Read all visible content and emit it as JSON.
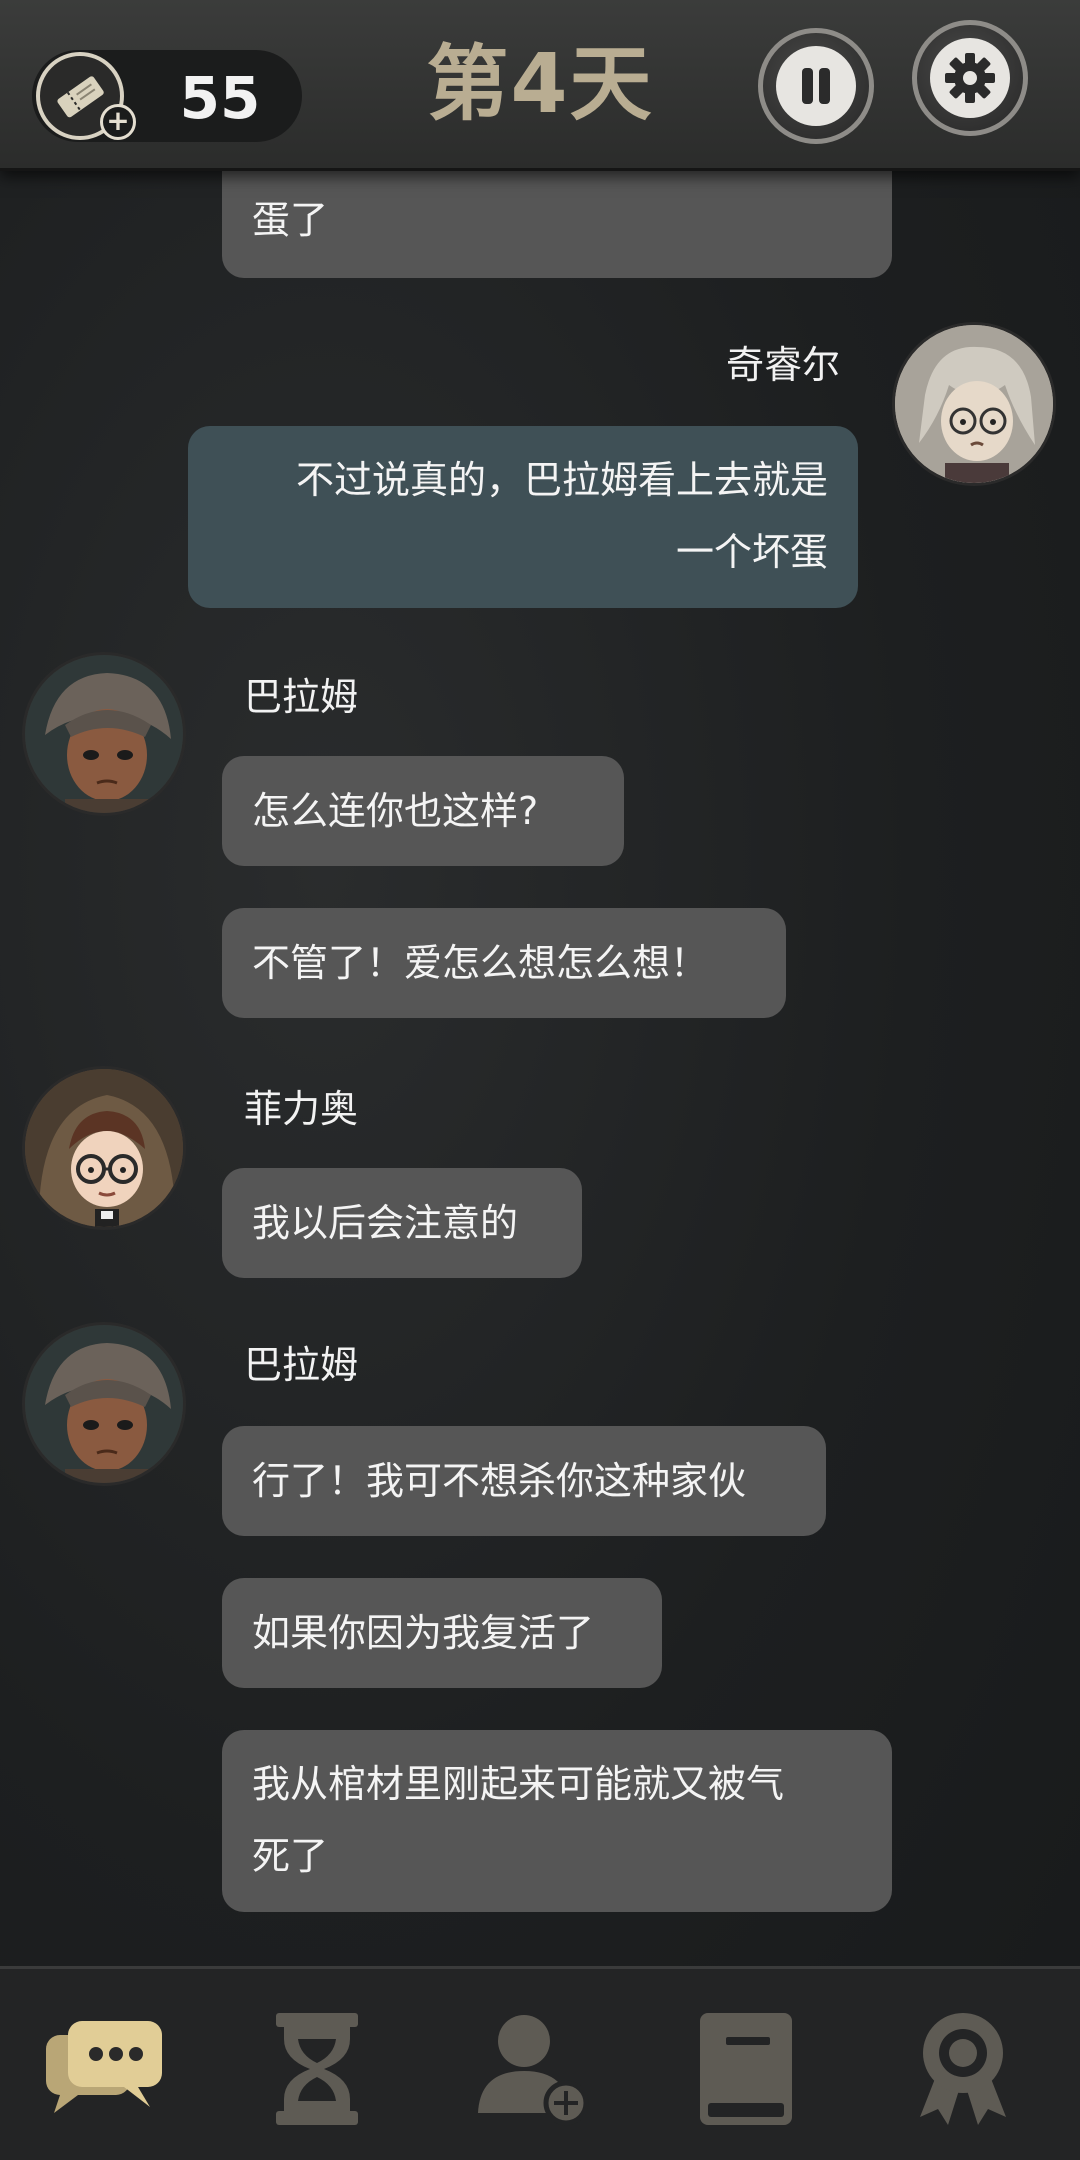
{
  "header": {
    "ticket_count": "55",
    "day_title": "第4天"
  },
  "chat": {
    "top_partial_text": "蛋了",
    "messages": [
      {
        "sender": "奇睿尔",
        "text_line1": "不过说真的，巴拉姆看上去就是",
        "text_line2": "一个坏蛋"
      },
      {
        "sender": "巴拉姆",
        "texts": [
          "怎么连你也这样?",
          "不管了！爱怎么想怎么想！"
        ]
      },
      {
        "sender": "菲力奥",
        "texts": [
          "我以后会注意的"
        ]
      },
      {
        "sender": "巴拉姆",
        "texts": [
          "行了！我可不想杀你这种家伙",
          "如果你因为我复活了"
        ],
        "long_line1": "我从棺材里刚起来可能就又被气",
        "long_line2": "死了"
      }
    ]
  },
  "nav": {
    "items": [
      "chat-icon",
      "hourglass-icon",
      "add-character-icon",
      "book-icon",
      "achievement-icon"
    ],
    "active": "chat-icon"
  },
  "colors": {
    "accent_active": "#d6c28e",
    "inactive_icon": "#5e5b54",
    "bubble_other": "#565656",
    "bubble_mine": "#3f5056"
  }
}
